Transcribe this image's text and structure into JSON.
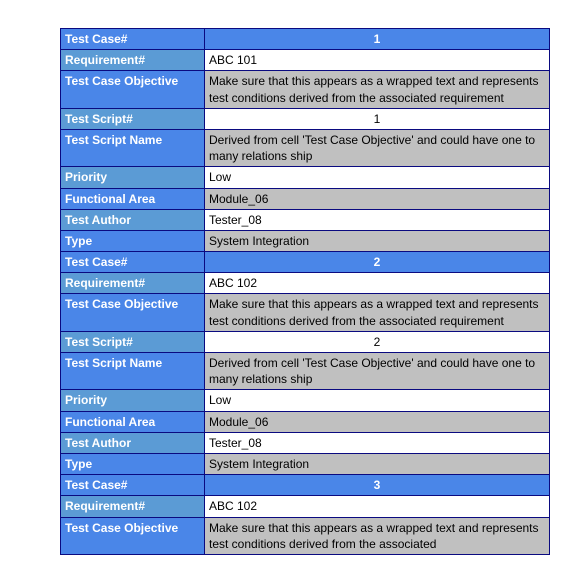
{
  "labels": {
    "test_case_num": "Test Case#",
    "requirement_num": "Requirement#",
    "objective": "Test Case Objective",
    "test_script_num": "Test Script#",
    "test_script_name": "Test Script Name",
    "priority": "Priority",
    "functional_area": "Functional Area",
    "test_author": "Test Author",
    "type": "Type"
  },
  "cases": [
    {
      "num": "1",
      "requirement": "ABC 101",
      "objective": "Make sure that this appears as a wrapped text and represents test conditions derived from the associated requirement",
      "script_num": "1",
      "script_name": "Derived from cell 'Test Case Objective'  and could have one to many relations ship",
      "priority": "Low",
      "functional_area": "Module_06",
      "test_author": "Tester_08",
      "type": "System Integration"
    },
    {
      "num": "2",
      "requirement": "ABC 102",
      "objective": "Make sure that this appears as a wrapped text and represents test conditions derived from the associated requirement",
      "script_num": "2",
      "script_name": "Derived from cell 'Test Case Objective'  and could have one to many relations ship",
      "priority": "Low",
      "functional_area": "Module_06",
      "test_author": "Tester_08",
      "type": "System Integration"
    },
    {
      "num": "3",
      "requirement": "ABC 102",
      "objective": "Make sure that this appears as a wrapped text and represents test conditions derived from the associated"
    }
  ]
}
